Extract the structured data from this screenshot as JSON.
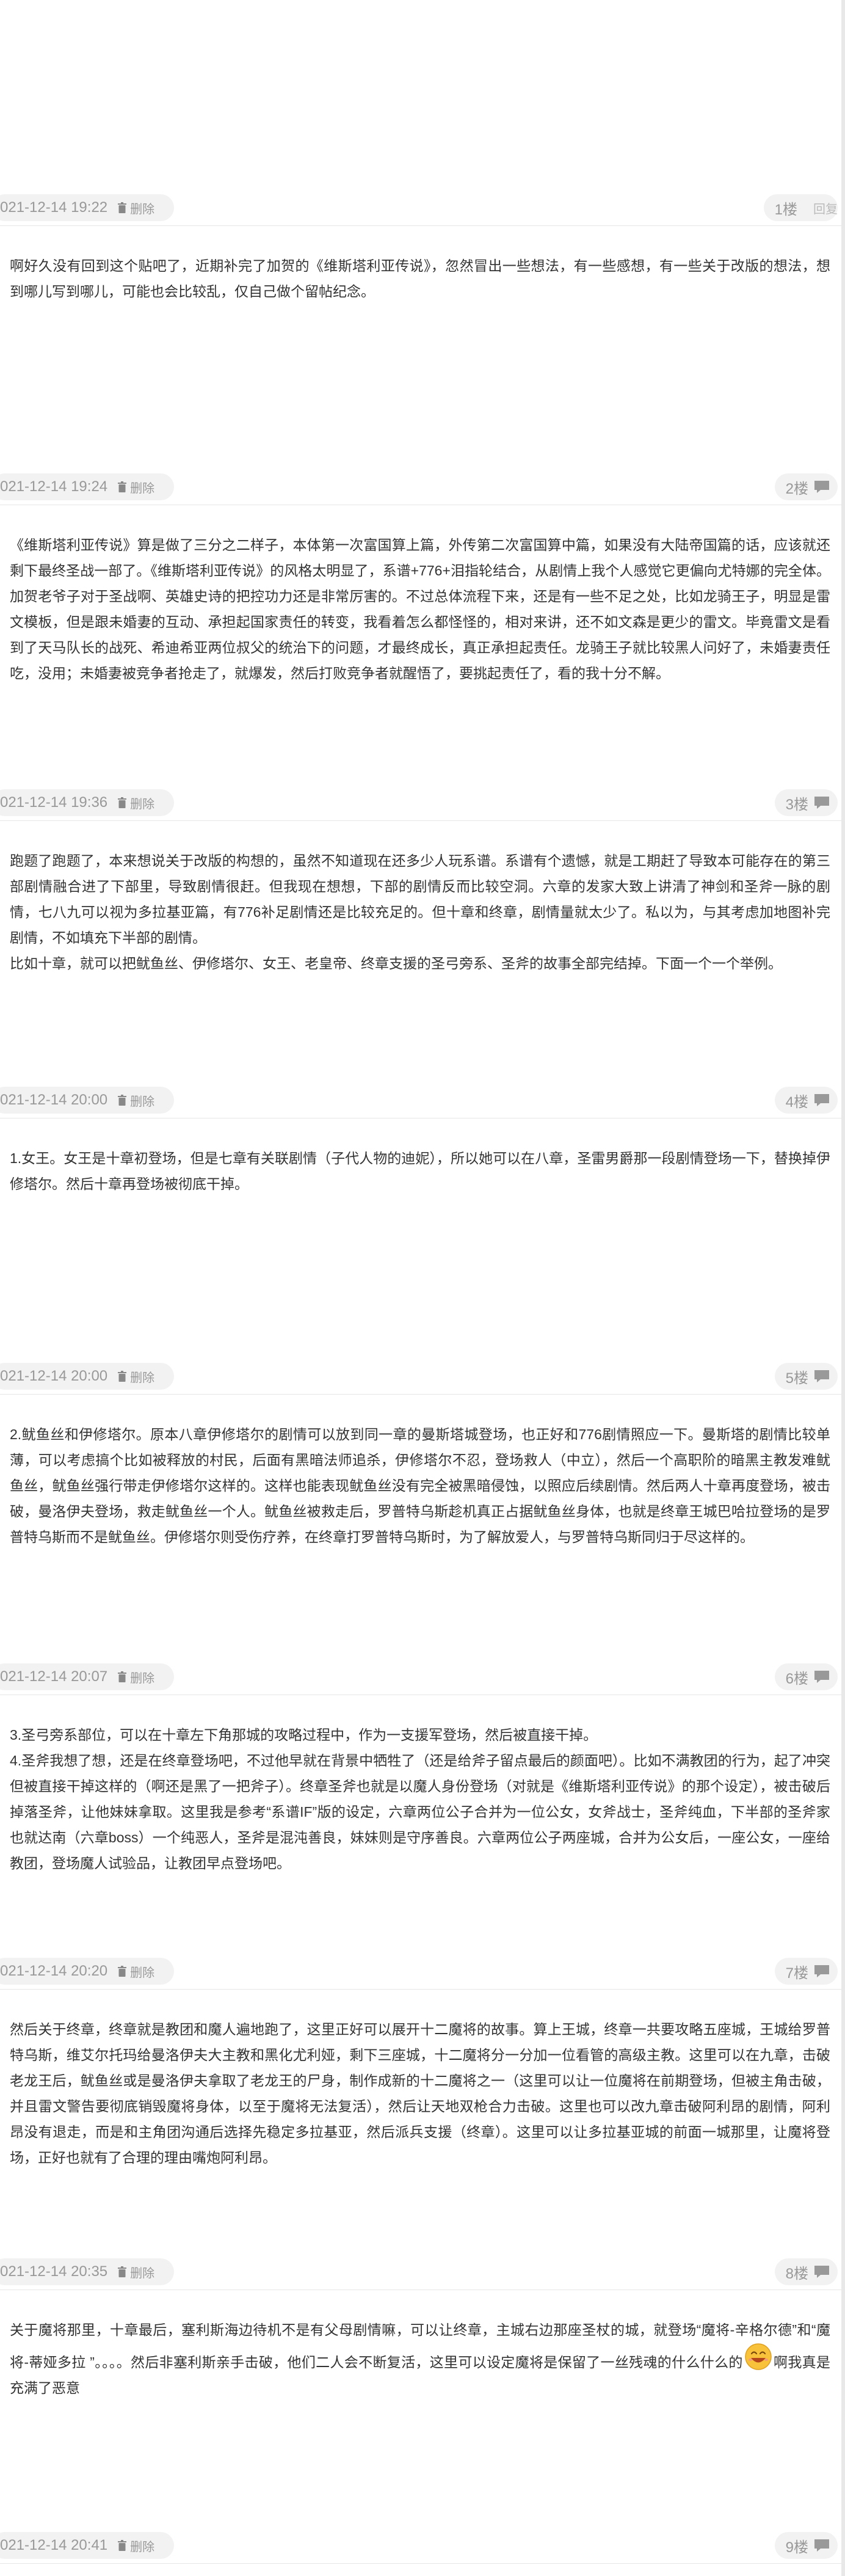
{
  "posts": [
    {
      "time": "021-12-14 19:22",
      "delete_label": "删除",
      "floor": "1楼",
      "reply_label": "回复",
      "content": []
    },
    {
      "time": "021-12-14 19:24",
      "delete_label": "删除",
      "floor": "2楼",
      "content": [
        "啊好久没有回到这个贴吧了，近期补完了加贺的《维斯塔利亚传说》，忽然冒出一些想法，有一些感想，有一些关于改版的想法，想到哪儿写到哪儿，可能也会比较乱，仅自己做个留帖纪念。"
      ]
    },
    {
      "time": "021-12-14 19:36",
      "delete_label": "删除",
      "floor": "3楼",
      "content": [
        "《维斯塔利亚传说》算是做了三分之二样子，本体第一次富国算上篇，外传第二次富国算中篇，如果没有大陆帝国篇的话，应该就还剩下最终圣战一部了。《维斯塔利亚传说》的风格太明显了，系谱+776+泪指轮结合，从剧情上我个人感觉它更偏向尤特娜的完全体。加贺老爷子对于圣战啊、英雄史诗的把控功力还是非常厉害的。不过总体流程下来，还是有一些不足之处，比如龙骑王子，明显是雷文模板，但是跟未婚妻的互动、承担起国家责任的转变，我看着怎么都怪怪的，相对来讲，还不如文森是更少的雷文。毕竟雷文是看到了天马队长的战死、希迪希亚两位叔父的统治下的问题，才最终成长，真正承担起责任。龙骑王子就比较黑人问好了，未婚妻责任吃，没用；未婚妻被竞争者抢走了，就爆发，然后打败竞争者就醒悟了，要挑起责任了，看的我十分不解。"
      ]
    },
    {
      "time": "021-12-14 20:00",
      "delete_label": "删除",
      "floor": "4楼",
      "content": [
        "跑题了跑题了，本来想说关于改版的构想的，虽然不知道现在还多少人玩系谱。系谱有个遗憾，就是工期赶了导致本可能存在的第三部剧情融合进了下部里，导致剧情很赶。但我现在想想，下部的剧情反而比较空洞。六章的发家大致上讲清了神剑和圣斧一脉的剧情，七八九可以视为多拉基亚篇，有776补足剧情还是比较充足的。但十章和终章，剧情量就太少了。私以为，与其考虑加地图补完剧情，不如填充下半部的剧情。",
        "比如十章，就可以把鱿鱼丝、伊修塔尔、女王、老皇帝、终章支援的圣弓旁系、圣斧的故事全部完结掉。下面一个一个举例。"
      ]
    },
    {
      "time": "021-12-14 20:00",
      "delete_label": "删除",
      "floor": "5楼",
      "content": [
        "1.女王。女王是十章初登场，但是七章有关联剧情（子代人物的迪妮），所以她可以在八章，圣雷男爵那一段剧情登场一下，替换掉伊修塔尔。然后十章再登场被彻底干掉。"
      ]
    },
    {
      "time": "021-12-14 20:07",
      "delete_label": "删除",
      "floor": "6楼",
      "content": [
        "2.鱿鱼丝和伊修塔尔。原本八章伊修塔尔的剧情可以放到同一章的曼斯塔城登场，也正好和776剧情照应一下。曼斯塔的剧情比较单薄，可以考虑搞个比如被释放的村民，后面有黑暗法师追杀，伊修塔尔不忍，登场救人（中立），然后一个高职阶的暗黑主教发难鱿鱼丝，鱿鱼丝强行带走伊修塔尔这样的。这样也能表现鱿鱼丝没有完全被黑暗侵蚀，以照应后续剧情。然后两人十章再度登场，被击破，曼洛伊夫登场，救走鱿鱼丝一个人。鱿鱼丝被救走后，罗普特乌斯趁机真正占据鱿鱼丝身体，也就是终章王城巴哈拉登场的是罗普特乌斯而不是鱿鱼丝。伊修塔尔则受伤疗养，在终章打罗普特乌斯时，为了解放爱人，与罗普特乌斯同归于尽这样的。"
      ]
    },
    {
      "time": "021-12-14 20:20",
      "delete_label": "删除",
      "floor": "7楼",
      "content": [
        "3.圣弓旁系部位，可以在十章左下角那城的攻略过程中，作为一支援军登场，然后被直接干掉。",
        "4.圣斧我想了想，还是在终章登场吧，不过他早就在背景中牺牲了（还是给斧子留点最后的颜面吧）。比如不满教团的行为，起了冲突但被直接干掉这样的（啊还是黑了一把斧子）。终章圣斧也就是以魔人身份登场（对就是《维斯塔利亚传说》的那个设定），被击破后掉落圣斧，让他妹妹拿取。这里我是参考“系谱IF”版的设定，六章两位公子合并为一位公女，女斧战士，圣斧纯血，下半部的圣斧家也就达南（六章boss）一个纯恶人，圣斧是混沌善良，妹妹则是守序善良。六章两位公子两座城，合并为公女后，一座公女，一座给教团，登场魔人试验品，让教团早点登场吧。"
      ]
    },
    {
      "time": "021-12-14 20:35",
      "delete_label": "删除",
      "floor": "8楼",
      "content": [
        "然后关于终章，终章就是教团和魔人遍地跑了，这里正好可以展开十二魔将的故事。算上王城，终章一共要攻略五座城，王城给罗普特乌斯，维艾尔托玛给曼洛伊夫大主教和黑化尤利娅，剩下三座城，十二魔将分一分加一位看管的高级主教。这里可以在九章，击破老龙王后，鱿鱼丝或是曼洛伊夫拿取了老龙王的尸身，制作成新的十二魔将之一（这里可以让一位魔将在前期登场，但被主角击破，并且雷文警告要彻底销毁魔将身体，以至于魔将无法复活），然后让天地双枪合力击破。这里也可以改九章击破阿利昂的剧情，阿利昂没有退走，而是和主角团沟通后选择先稳定多拉基亚，然后派兵支援（终章）。这里可以让多拉基亚城的前面一城那里，让魔将登场，正好也就有了合理的理由嘴炮阿利昂。"
      ]
    },
    {
      "time": "021-12-14 20:41",
      "delete_label": "删除",
      "floor": "9楼",
      "content_before_emoji": "关于魔将那里，十章最后，塞利斯海边待机不是有父母剧情嘛，可以让终章，主城右边那座圣杖的城，就登场“魔将-辛格尔德”和“魔将-蒂娅多拉 ”。。。。然后非塞利斯亲手击破，他们二人会不断复活，这里可以设定魔将是保留了一丝残魂的什么什么的",
      "emoji_name": "laughing-emoji",
      "content_after_emoji": "啊我真是充满了恶意"
    }
  ]
}
